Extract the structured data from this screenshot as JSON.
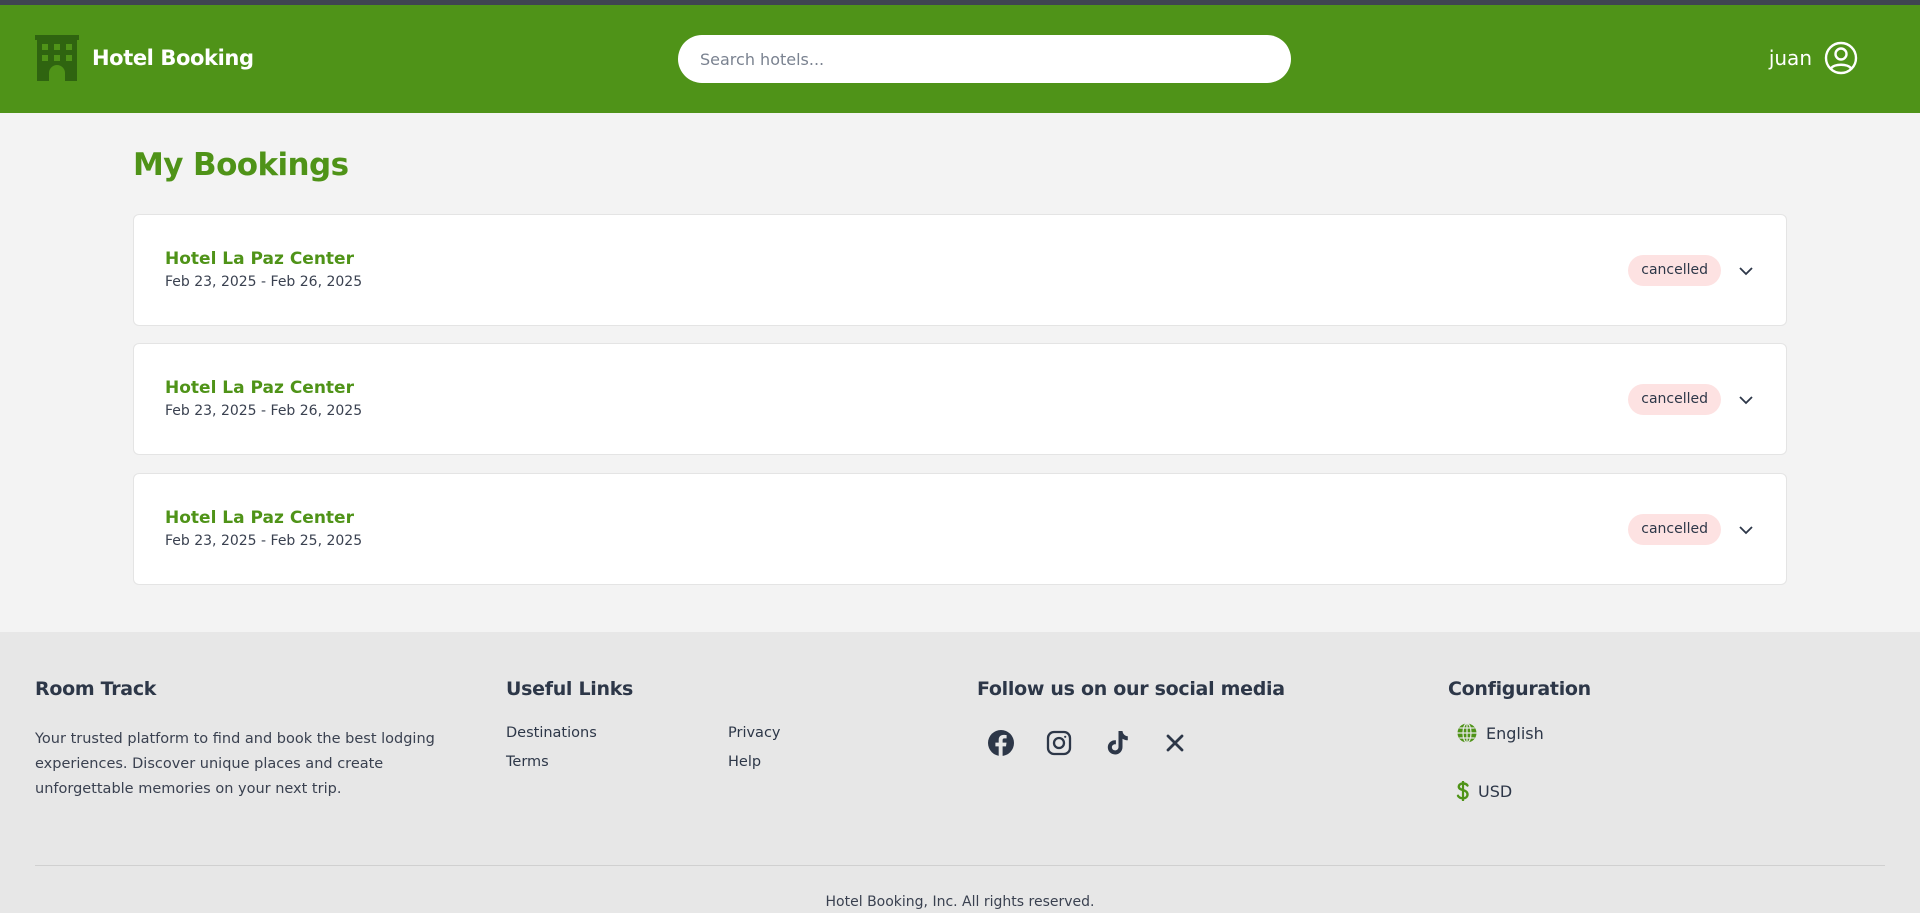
{
  "header": {
    "brand_name": "Hotel Booking",
    "brand_icon": "hotel-building-icon",
    "search_placeholder": "Search hotels...",
    "search_value": "",
    "username": "juan",
    "user_icon": "user-circle-icon"
  },
  "colors": {
    "brand_green": "#4f9318",
    "top_strip": "#3f4451",
    "page_bg": "#f3f3f3",
    "footer_bg": "#e7e7e7",
    "status_cancelled_bg": "#fde2e2"
  },
  "main": {
    "title": "My Bookings",
    "bookings": [
      {
        "hotel": "Hotel La Paz Center",
        "dates": "Feb 23, 2025 - Feb 26, 2025",
        "status": "cancelled",
        "expand_icon": "chevron-down-icon"
      },
      {
        "hotel": "Hotel La Paz Center",
        "dates": "Feb 23, 2025 - Feb 26, 2025",
        "status": "cancelled",
        "expand_icon": "chevron-down-icon"
      },
      {
        "hotel": "Hotel La Paz Center",
        "dates": "Feb 23, 2025 - Feb 25, 2025",
        "status": "cancelled",
        "expand_icon": "chevron-down-icon"
      }
    ]
  },
  "footer": {
    "about": {
      "title": "Room Track",
      "text": "Your trusted platform to find and book the best lodging experiences. Discover unique places and create unforgettable memories on your next trip."
    },
    "links": {
      "title": "Useful Links",
      "items": [
        "Destinations",
        "Privacy",
        "Terms",
        "Help"
      ]
    },
    "social": {
      "title": "Follow us on our social media",
      "icons": [
        "facebook-icon",
        "instagram-icon",
        "tiktok-icon",
        "x-icon"
      ]
    },
    "config": {
      "title": "Configuration",
      "language": "English",
      "language_icon": "globe-icon",
      "currency": "USD",
      "currency_icon": "dollar-icon"
    },
    "copyright": "Hotel Booking, Inc. All rights reserved."
  }
}
